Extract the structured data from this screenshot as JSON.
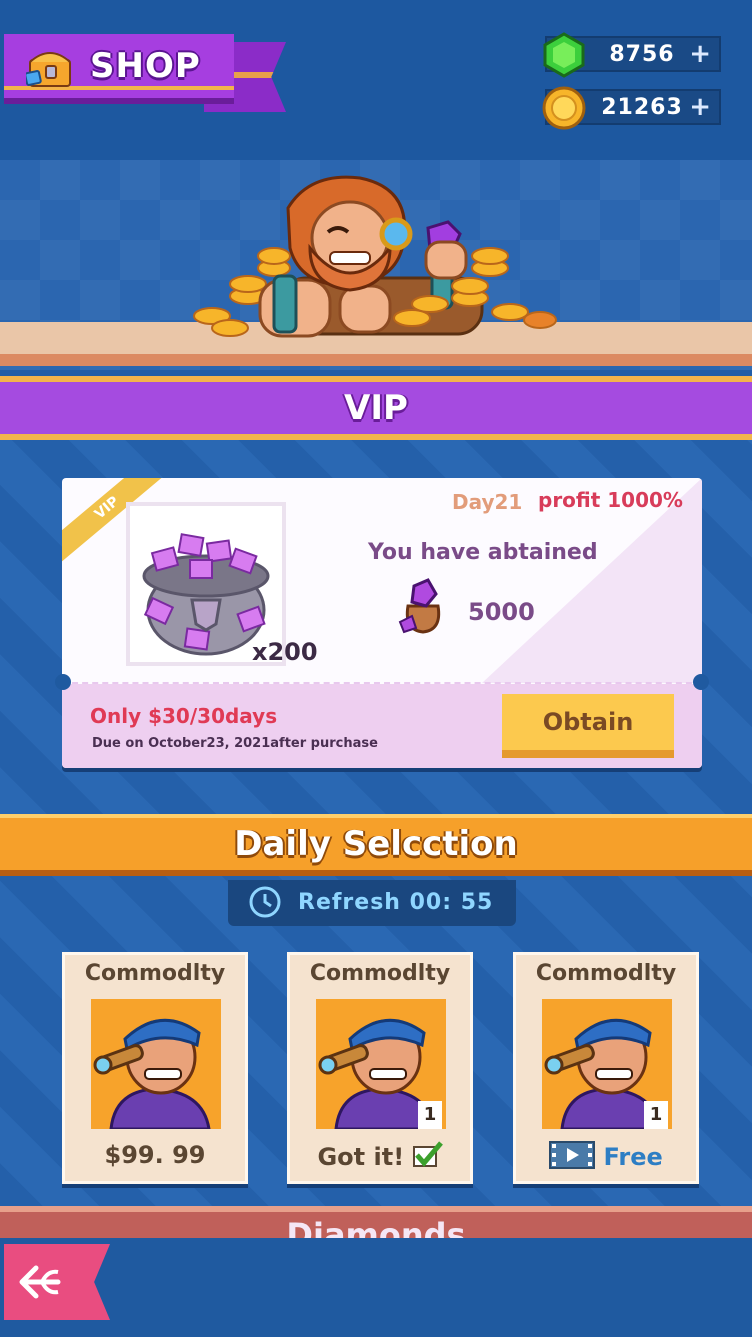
{
  "header": {
    "shop_label": "SHOP",
    "gems": {
      "value": "8756",
      "plus": "+"
    },
    "coins": {
      "value": "21263",
      "plus": "+"
    }
  },
  "vip": {
    "section_title": "VIP",
    "corner_tag": "VIP",
    "day": "Day21",
    "profit": "profit 1000%",
    "item_qty": "x200",
    "obtained_label": "You have abtained",
    "obtained_value": "5000",
    "price": "Only $30/30days",
    "due": "Due on October23, 2021after purchase",
    "obtain_button": "Obtain"
  },
  "daily": {
    "section_title": "Daily Selcction",
    "refresh": "Refresh 00: 55",
    "cards": [
      {
        "title": "Commodlty",
        "footer": "$99. 99",
        "badge": ""
      },
      {
        "title": "Commodlty",
        "footer": "Got it!",
        "badge": "1"
      },
      {
        "title": "Commodlty",
        "footer": "Free",
        "badge": "1"
      }
    ]
  },
  "next_section": {
    "title": "Diamonds"
  },
  "colors": {
    "background": "#225ea6",
    "vip_purple": "#a54be0",
    "daily_orange": "#f6a02a",
    "obtain_yellow": "#fcc94e",
    "price_red": "#e03a55",
    "back_pink": "#e94d80"
  },
  "icons": {
    "shop": "treasure-chest-icon",
    "gem": "green-gem-icon",
    "coin": "gold-coin-icon",
    "clock": "clock-icon",
    "check": "check-icon",
    "video": "video-film-icon",
    "back": "back-arrow-icon"
  }
}
